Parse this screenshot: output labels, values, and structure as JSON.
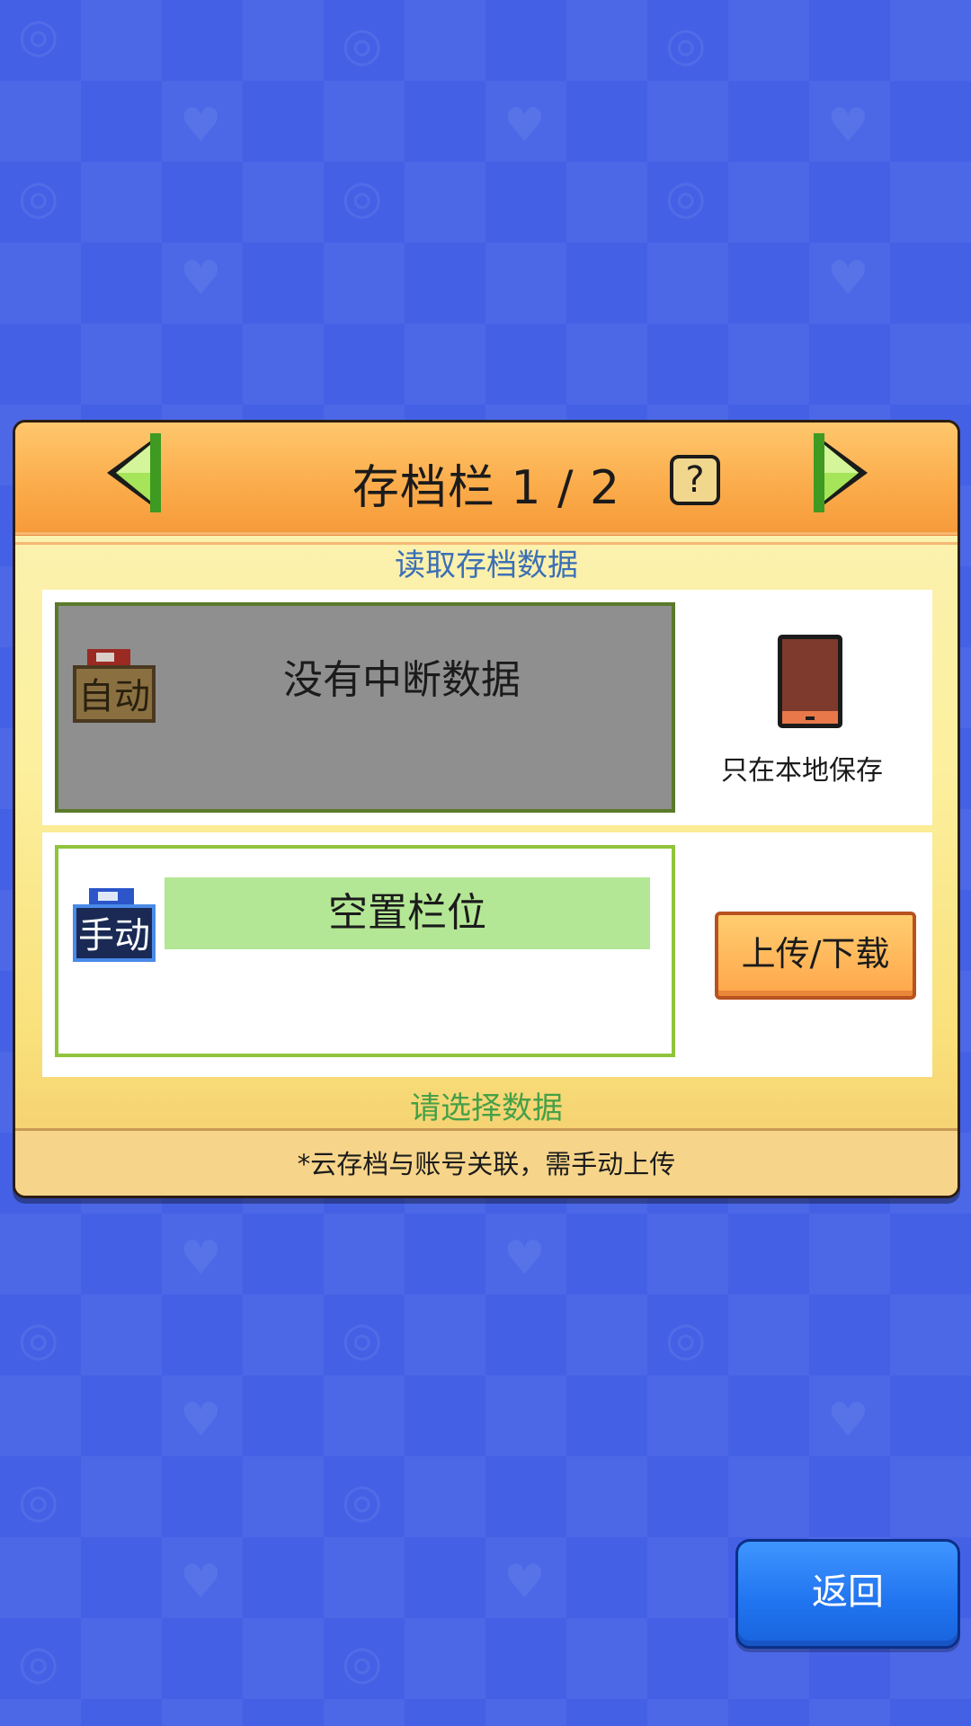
{
  "header": {
    "title": "存档栏 1 / 2",
    "help_icon": "question-mark-icon",
    "prev_icon": "left-arrow-icon",
    "next_icon": "right-arrow-icon"
  },
  "labels": {
    "read": "读取存档数据",
    "select": "请选择数据"
  },
  "slots": [
    {
      "badge": "自动",
      "badge_icon": "auto-save-icon",
      "text": "没有中断数据",
      "storage_icon": "phone-icon",
      "storage_text": "只在本地保存"
    },
    {
      "badge": "手动",
      "badge_icon": "manual-save-icon",
      "text": "空置栏位",
      "action": "上传/下载"
    }
  ],
  "footer_note": "*云存档与账号关联，需手动上传",
  "back_label": "返回",
  "colors": {
    "background": "#4461e6",
    "header_orange": "#fbab4a",
    "panel_cream": "#fcef9d",
    "read_label": "#3b6fb6",
    "select_label": "#45a047",
    "back_button": "#2073ef"
  }
}
